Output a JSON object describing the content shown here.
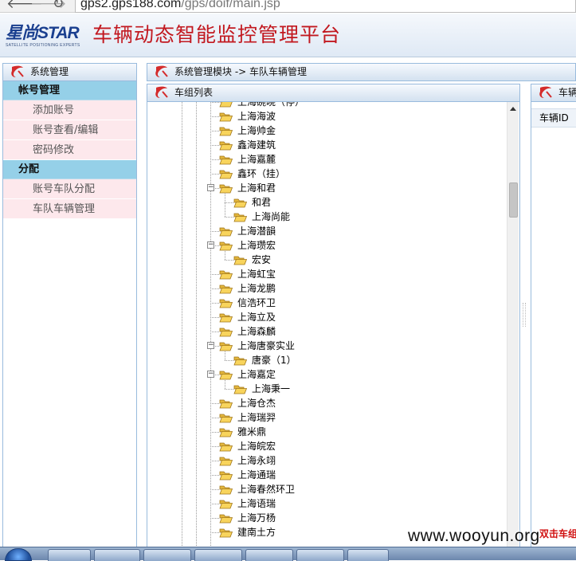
{
  "browser": {
    "url_main": "gps2.gps188.com",
    "url_path": "/gps/doif/main.jsp"
  },
  "header": {
    "logo_cn": "星尚",
    "logo_en": "STAR",
    "logo_tagline": "SATELLITE POSITIONING EXPERTS",
    "title": "车辆动态智能监控管理平台"
  },
  "sidebar": {
    "title": "系统管理",
    "groups": [
      {
        "label": "帐号管理",
        "items": [
          "添加账号",
          "账号查看/编辑",
          "密码修改"
        ]
      },
      {
        "label": "分配",
        "items": [
          "账号车队分配",
          "车队车辆管理"
        ]
      }
    ]
  },
  "breadcrumb": "系统管理模块 -> 车队车辆管理",
  "tree": {
    "title": "车组列表",
    "nodes": [
      {
        "label": "上海碗晓（停）",
        "depth": 0
      },
      {
        "label": "上海海波",
        "depth": 0
      },
      {
        "label": "上海帅金",
        "depth": 0
      },
      {
        "label": "鑫海建筑",
        "depth": 0
      },
      {
        "label": "上海嘉麓",
        "depth": 0
      },
      {
        "label": "鑫环（挂）",
        "depth": 0
      },
      {
        "label": "上海和君",
        "depth": 0,
        "expanded": true
      },
      {
        "label": "和君",
        "depth": 1
      },
      {
        "label": "上海尚能",
        "depth": 1
      },
      {
        "label": "上海潜韻",
        "depth": 0
      },
      {
        "label": "上海瓒宏",
        "depth": 0,
        "expanded": true
      },
      {
        "label": "宏安",
        "depth": 1
      },
      {
        "label": "上海虹宝",
        "depth": 0
      },
      {
        "label": "上海龙鹏",
        "depth": 0
      },
      {
        "label": "信浩环卫",
        "depth": 0
      },
      {
        "label": "上海立及",
        "depth": 0
      },
      {
        "label": "上海森麟",
        "depth": 0
      },
      {
        "label": "上海唐豪实业",
        "depth": 0,
        "expanded": true
      },
      {
        "label": "唐豪（1）",
        "depth": 1
      },
      {
        "label": "上海嘉定",
        "depth": 0,
        "expanded": true
      },
      {
        "label": "上海秉一",
        "depth": 1
      },
      {
        "label": "上海仓杰",
        "depth": 0
      },
      {
        "label": "上海瑞羿",
        "depth": 0
      },
      {
        "label": "雅米鼎",
        "depth": 0
      },
      {
        "label": "上海皖宏",
        "depth": 0
      },
      {
        "label": "上海永翊",
        "depth": 0
      },
      {
        "label": "上海通瑞",
        "depth": 0
      },
      {
        "label": "上海春然环卫",
        "depth": 0
      },
      {
        "label": "上海语瑞",
        "depth": 0
      },
      {
        "label": "上海万杨",
        "depth": 0
      },
      {
        "label": "建南土方",
        "depth": 0
      }
    ]
  },
  "vehicle_panel": {
    "title": "车辆",
    "column": "车辆ID",
    "hint": "双击车组"
  },
  "watermark": "www.wooyun.org",
  "colors": {
    "title_red": "#c2181f",
    "menu_group": "#95d0e8",
    "menu_item": "#fde8ec",
    "border": "#99bbdd"
  }
}
